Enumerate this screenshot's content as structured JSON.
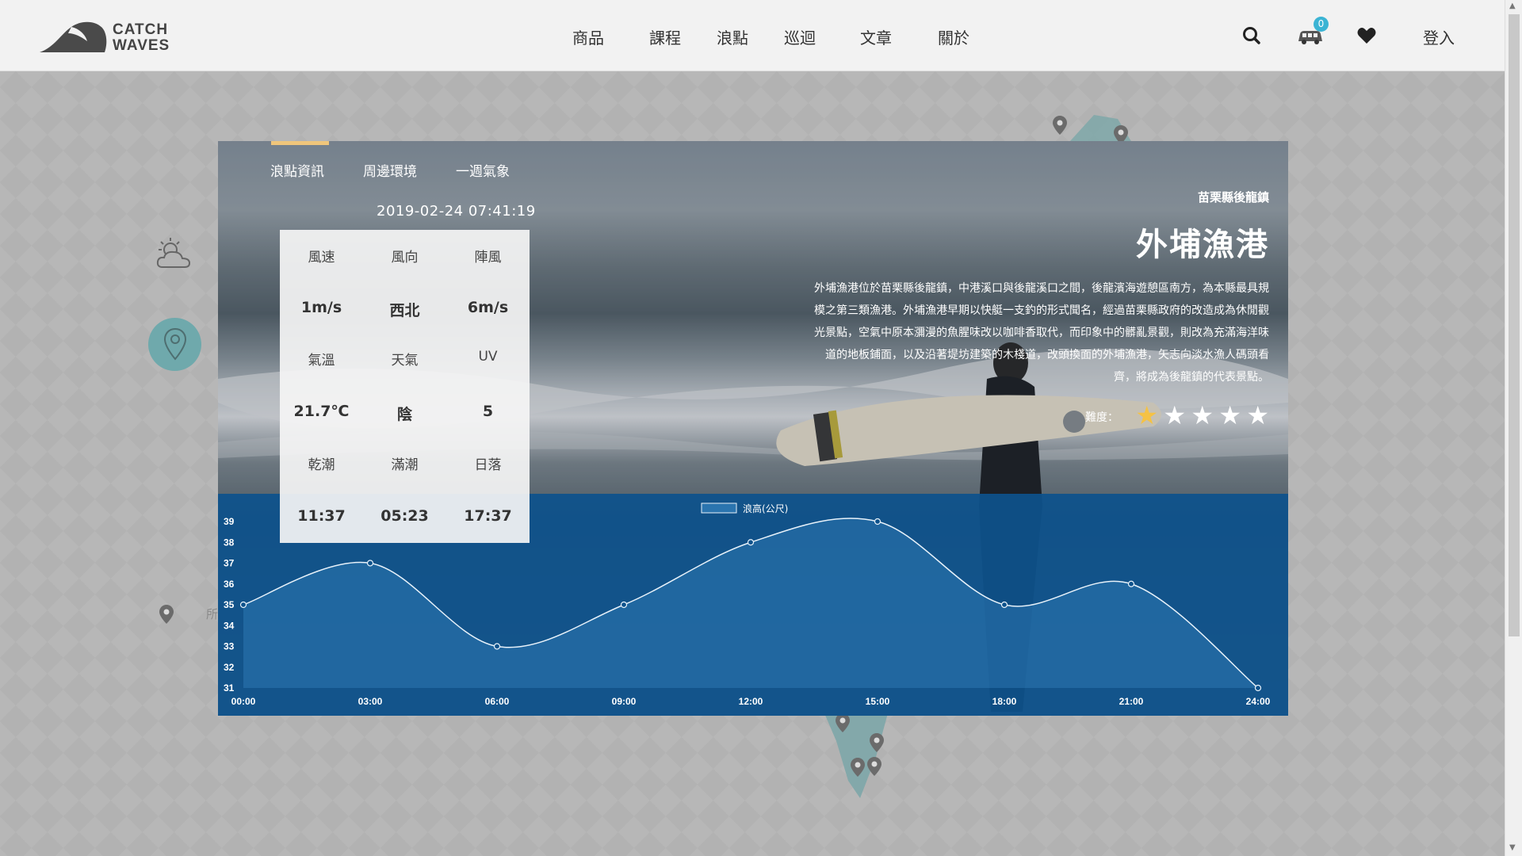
{
  "header": {
    "brand": [
      "CATCH",
      "WAVES"
    ],
    "nav": [
      "商品",
      "課程",
      "浪點",
      "巡迴",
      "文章",
      "關於"
    ],
    "cart_count": "0",
    "login_label": "登入",
    "icons": [
      "search-icon",
      "cart-icon",
      "heart-icon"
    ]
  },
  "tabs": [
    "浪點資訊",
    "周邊環境",
    "一週氣象"
  ],
  "timestamp": "2019-02-24 07:41:19",
  "conditions": {
    "rows": [
      {
        "labels": [
          "風速",
          "風向",
          "陣風"
        ],
        "values": [
          "1m/s",
          "西北",
          "6m/s"
        ]
      },
      {
        "labels": [
          "氣溫",
          "天氣",
          "UV"
        ],
        "values": [
          "21.7℃",
          "陰",
          "5"
        ]
      },
      {
        "labels": [
          "乾潮",
          "滿潮",
          "日落"
        ],
        "values": [
          "11:37",
          "05:23",
          "17:37"
        ]
      }
    ]
  },
  "spot": {
    "location": "苗栗縣後龍鎮",
    "title": "外埔漁港",
    "description_lines": [
      "外埔漁港位於苗栗縣後龍鎮，中港溪口與後龍溪口之間，後龍濱海遊憩區南方，為本縣最具規",
      "模之第三類漁港。外埔漁港早期以快艇一支釣的形式聞名，經過苗栗縣政府的改造成為休閒觀",
      "光景點，空氣中原本瀰漫的魚腥味改以咖啡香取代，而印象中的髒亂景觀，則改為充滿海洋味",
      "道的地板鋪面，以及沿著堤坊建築的木棧道，改頭換面的外埔漁港，矢志向淡水漁人碼頭看",
      "齊，將成為後龍鎮的代表景點。"
    ],
    "difficulty_label": "難度：",
    "difficulty_rating": 1,
    "difficulty_max": 5
  },
  "side_partial_text": "所",
  "colors": {
    "accent": "#f0c67b",
    "chart_bg": "#0d528c",
    "badge": "#3bb4d4",
    "pin": "#6fa9ac",
    "star_filled": "#f5c244",
    "star_empty": "#ffffff"
  },
  "chart_data": {
    "type": "area",
    "x": [
      "00:00",
      "03:00",
      "06:00",
      "09:00",
      "12:00",
      "15:00",
      "18:00",
      "21:00",
      "24:00"
    ],
    "series": [
      {
        "name": "浪高(公尺)",
        "values": [
          35,
          37,
          33,
          35,
          38,
          39,
          35,
          36,
          31
        ]
      }
    ],
    "ylim": [
      31,
      39
    ],
    "yticks": [
      31,
      32,
      33,
      34,
      35,
      36,
      37,
      38,
      39
    ],
    "legend_position": "top-center",
    "grid": false
  }
}
